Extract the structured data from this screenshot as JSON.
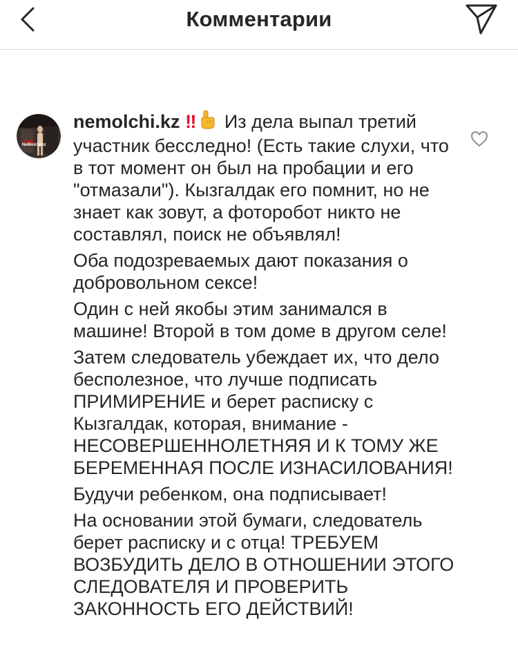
{
  "header": {
    "title": "Комментарии",
    "back_icon": "chevron-left-icon",
    "share_icon": "paper-plane-icon"
  },
  "comment": {
    "username": "nemolchi.kz",
    "emoji_bang": "‼",
    "emoji_hand": "point-up-hand-icon",
    "avatar_text": "NeMolchi.kz",
    "paragraphs": [
      "Из дела выпал третий участник бесследно! (Есть такие слухи, что в тот момент он был на пробации и его \"отмазали\"). Кызгалдак его помнит, но не знает как зовут, а фоторобот никто не составлял, поиск не объявлял!",
      "Оба подозреваемых дают показания о добровольном сексе!",
      "Один с ней якобы этим занимался в машине! Второй в том доме в другом селе!",
      "Затем следователь убеждает их, что дело бесполезное, что лучше подписать ПРИМИРЕНИЕ и берет расписку с Кызгалдак, которая, внимание - НЕСОВЕРШЕННОЛЕТНЯЯ И К ТОМУ ЖЕ БЕРЕМЕННАЯ ПОСЛЕ ИЗНАСИЛОВАНИЯ!",
      "Будучи ребенком, она подписывает!",
      "На основании этой бумаги, следователь берет расписку и с отца! ТРЕБУЕМ ВОЗБУДИТЬ ДЕЛО В ОТНОШЕНИИ ЭТОГО СЛЕДОВАТЕЛЯ И ПРОВЕРИТЬ ЗАКОННОСТЬ ЕГО ДЕЙСТВИЙ!"
    ],
    "like_icon": "heart-outline-icon"
  },
  "colors": {
    "text": "#262626",
    "divider": "#d8d8d8",
    "emoji_red": "#e0112b"
  }
}
